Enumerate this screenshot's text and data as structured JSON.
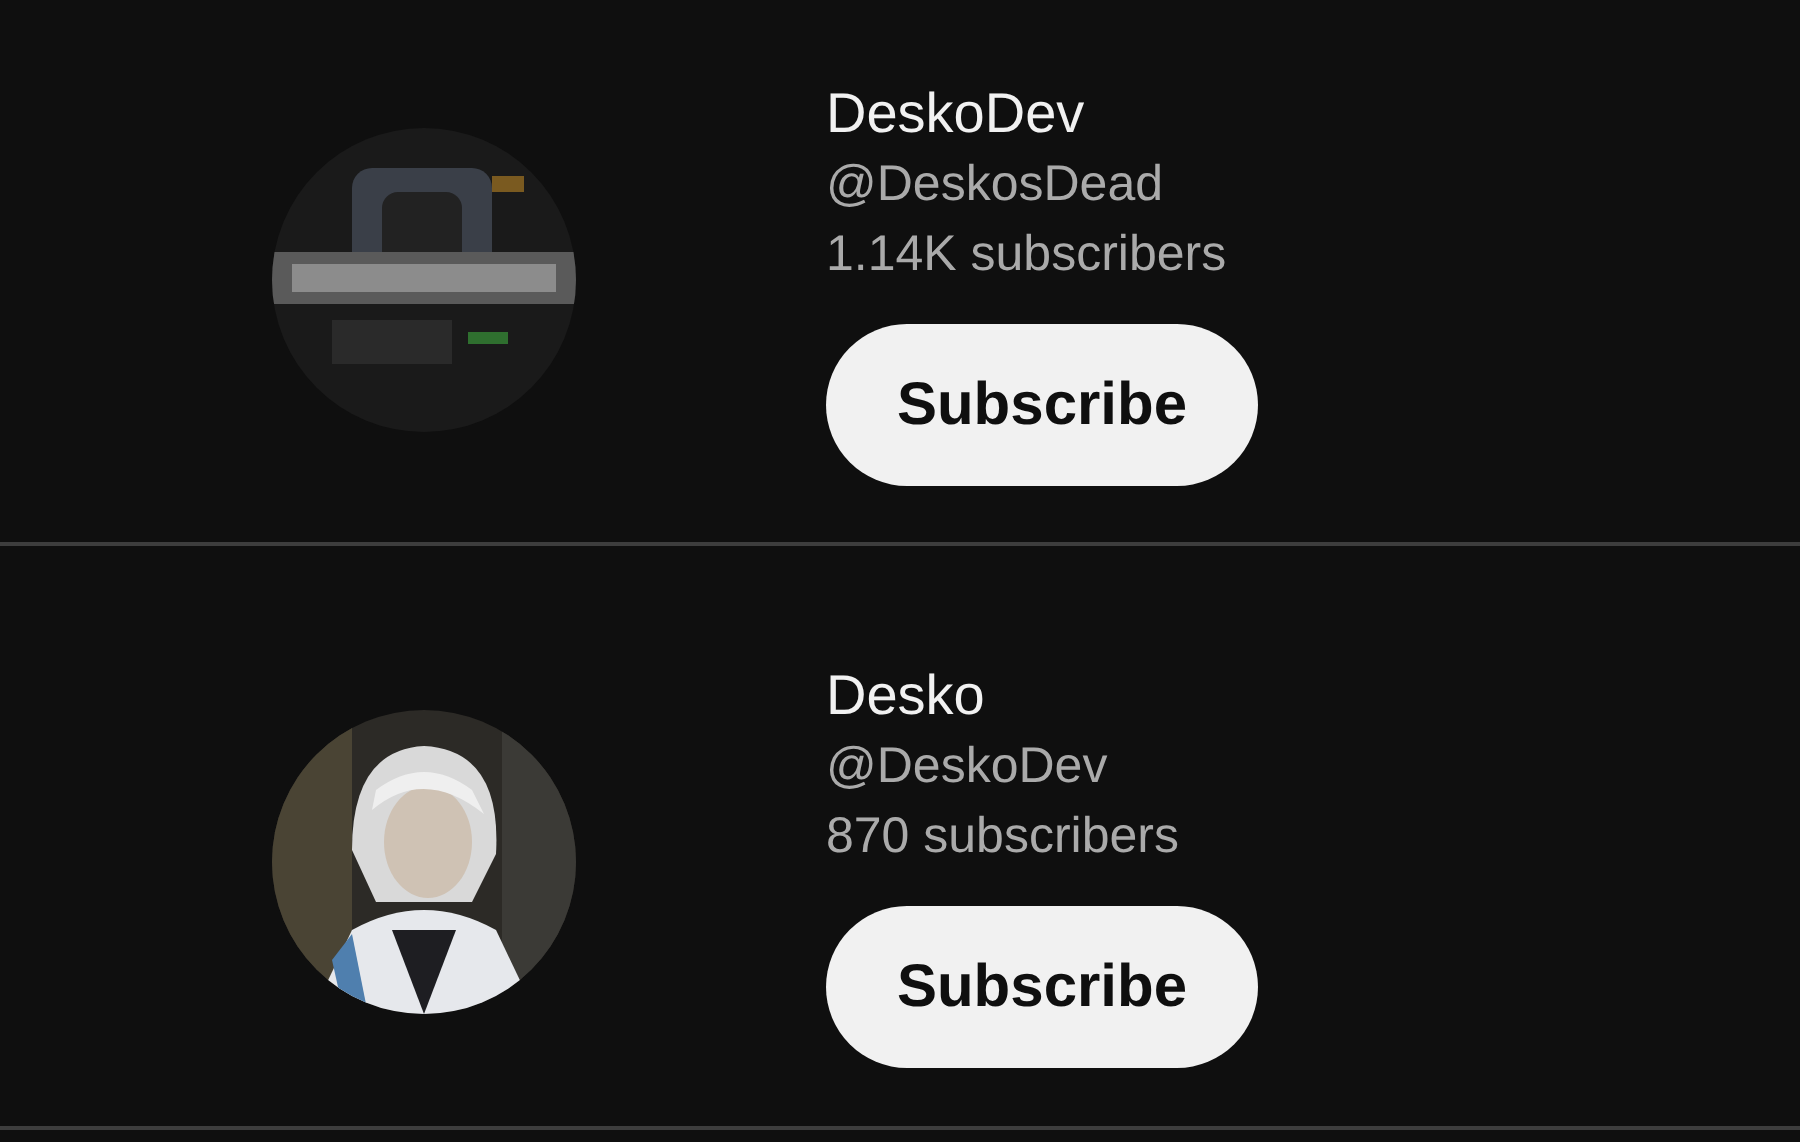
{
  "channels": [
    {
      "name": "DeskoDev",
      "handle": "@DeskosDead",
      "subscribers": "1.14K subscribers",
      "button": "Subscribe"
    },
    {
      "name": "Desko",
      "handle": "@DeskoDev",
      "subscribers": "870 subscribers",
      "button": "Subscribe"
    }
  ]
}
